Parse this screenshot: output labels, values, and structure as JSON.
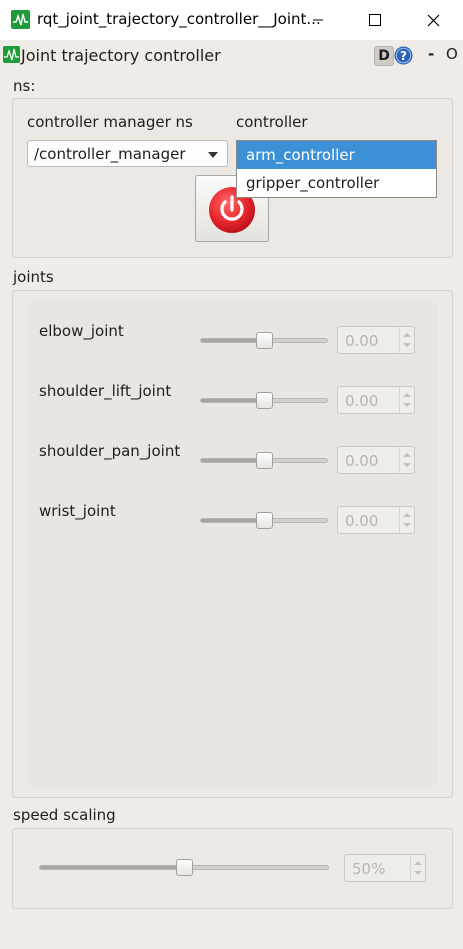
{
  "window": {
    "title": "rqt_joint_trajectory_controller__Joint...",
    "minimize_glyph": "–",
    "close_glyph": "✕"
  },
  "plugin": {
    "title": "Joint trajectory controller",
    "d_label": "D",
    "dash_label": "-",
    "o_label": "O"
  },
  "ns": {
    "group_label": "ns:",
    "cm_label": "controller manager ns",
    "controller_label": "controller",
    "cm_selected": "/controller_manager",
    "controller_options": [
      "arm_controller",
      "gripper_controller"
    ],
    "controller_highlighted": "arm_controller",
    "power_color": "#e8262d"
  },
  "joints": {
    "group_label": "joints",
    "items": [
      {
        "name": "elbow_joint",
        "value": "0.00",
        "level": 0.5
      },
      {
        "name": "shoulder_lift_joint",
        "value": "0.00",
        "level": 0.5
      },
      {
        "name": "shoulder_pan_joint",
        "value": "0.00",
        "level": 0.5
      },
      {
        "name": "wrist_joint",
        "value": "0.00",
        "level": 0.5
      }
    ]
  },
  "speed": {
    "group_label": "speed scaling",
    "value": "50%",
    "level": 0.5
  },
  "colors": {
    "selection": "#3b90d6",
    "icon_green": "#1f9b3a"
  }
}
